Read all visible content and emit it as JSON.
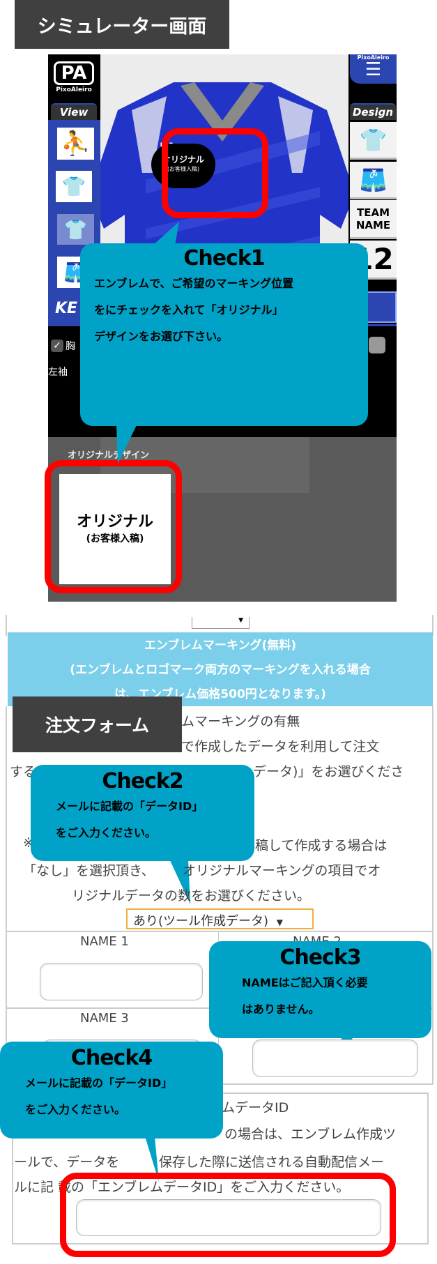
{
  "header_simulator": "シミュレーター画面",
  "header_order": "注文フォーム",
  "simulator": {
    "logo_text": "PixoAleiro",
    "logo_mark": "PA",
    "menu_label": "PixoAleiro",
    "view_tab": "View",
    "design_tab": "Design",
    "view_icons": [
      "player-icon",
      "kit-icon",
      "shirt-icon",
      "shorts-icon"
    ],
    "design_items": {
      "shirt": "shirt-icon",
      "shorts": "shorts-icon",
      "team_name": "TEAM NAME",
      "number": "12"
    },
    "brand_partial": "KE",
    "emblem_text": "オリジナル",
    "emblem_sub": "(お客様入稿)",
    "chest_checkbox": "胸",
    "chest_checked": true,
    "left_sleeve": "左袖",
    "original_design_label": "オリジナルデザイン",
    "card_title": "オリジナル",
    "card_sub": "(お客様入稿)"
  },
  "callouts": {
    "check1": {
      "title": "Check1",
      "lines": [
        "エンブレムで、ご希望のマーキング位置",
        "をにチェックを入れて「オリジナル」",
        "デザインをお選び下さい。"
      ]
    },
    "check2": {
      "title": "Check2",
      "lines": [
        "メールに記載の「データID」",
        "をご入力ください。"
      ]
    },
    "check3": {
      "title": "Check3",
      "lines": [
        "NAMEはご記入頂く必要",
        "はありません。"
      ]
    },
    "check4": {
      "title": "Check4",
      "lines": [
        "メールに記載の「データID」",
        "をご入力ください。"
      ]
    }
  },
  "form": {
    "top_select_value": "",
    "banner_lines": [
      "エンブレムマーキング(無料)",
      "(エンブレムとロゴマーク両方のマーキングを入れる場合",
      "は、エンブレム価格500円となります。)"
    ],
    "emblem_title_partial": "ムマーキングの有無",
    "desc_fragments": [
      "で作成したデータを利用して注文",
      "する",
      "データ)」をお選びくださ",
      "※",
      "稿して作成する場合は",
      "「なし」を選択頂き、",
      "オリジナルマーキングの項目でオ",
      "リジナルデータの数をお選びください。"
    ],
    "emblem_select_value": "あり(ツール作成データ)",
    "names": [
      "NAME 1",
      "NAME 2",
      "NAME 3"
    ],
    "data_id_title_partial": "ムデータID",
    "data_id_fragments": [
      "の場合は、エンブレム作成ツ",
      "ールで、データを",
      "保存した際に送信される自動配信メー",
      "ルに記",
      "載の「エンブレムデータID」をご入力ください。"
    ],
    "data_id_value": ""
  },
  "colors": {
    "callout": "#00a2c7",
    "banner": "#7bcfea",
    "highlight": "#ff0000",
    "header": "#404040",
    "select_border": "#f0b040"
  }
}
